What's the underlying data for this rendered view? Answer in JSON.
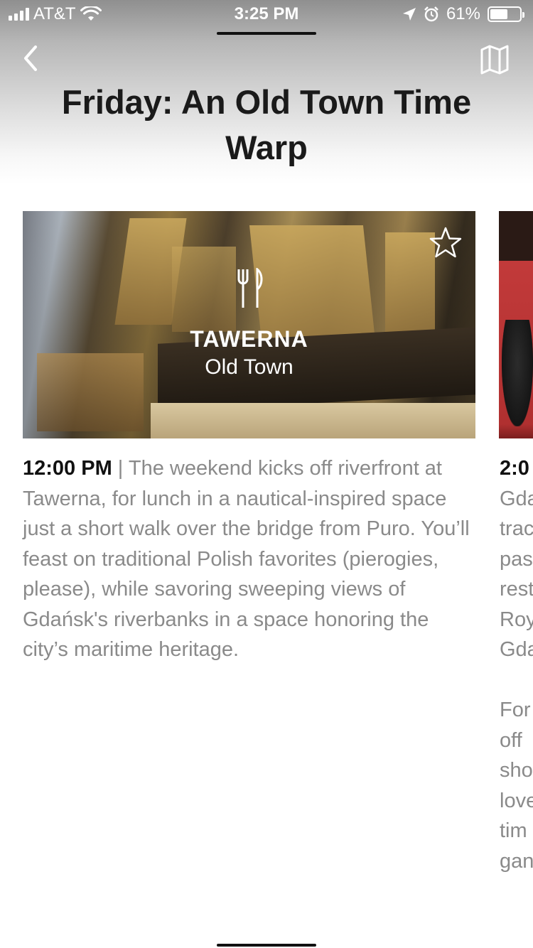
{
  "status_bar": {
    "carrier": "AT&T",
    "time": "3:25 PM",
    "battery": "61%",
    "battery_level": 0.61
  },
  "header": {
    "title": "Friday: An Old Town Time Warp",
    "back_icon": "chevron-left-icon",
    "map_icon": "map-icon"
  },
  "cards": [
    {
      "category_icon": "fork-knife-icon",
      "name": "TAWERNA",
      "area": "Old Town",
      "favorite_icon": "star-outline-icon",
      "time": "12:00 PM",
      "separator": "|",
      "description": "The weekend kicks off riverfront at Tawerna, for lunch in a nautical-inspired space just a short walk over the bridge from Puro. You’ll feast on traditional Polish favorites (pierogies, please), while savoring sweeping views of Gdańsk's riverbanks in a space honoring the city’s maritime heritage."
    },
    {
      "time": "2:0",
      "description": "Gda\ntrac\npas\nrest\nRoy\nGda\n\nFor\noff\nsho\nlove\ntim\ngan"
    }
  ],
  "colors": {
    "text_dark": "#111111",
    "text_muted": "#8a8a8a",
    "header_gradient_top": "#8f8f8f"
  }
}
